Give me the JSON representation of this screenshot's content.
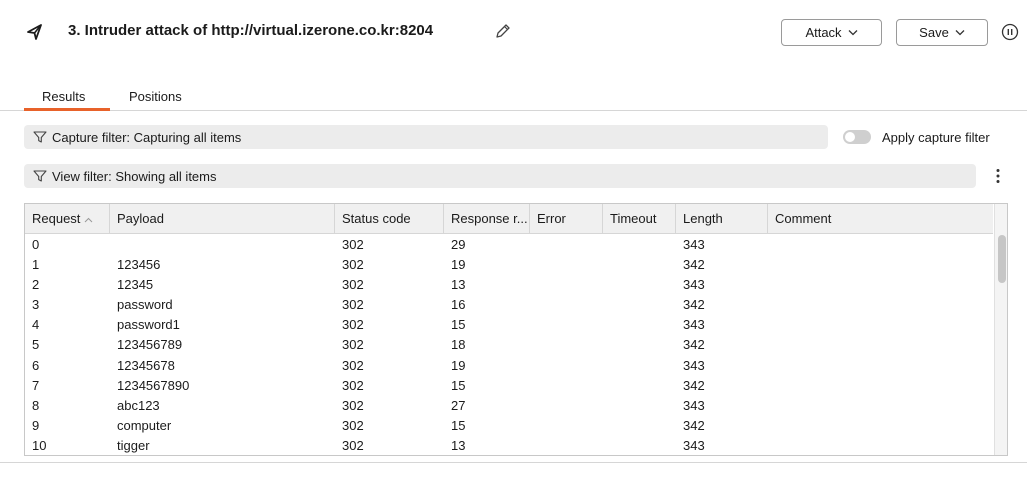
{
  "header": {
    "title": "3. Intruder attack of http://virtual.izerone.co.kr:8204",
    "attack_label": "Attack",
    "save_label": "Save"
  },
  "tabs": [
    {
      "label": "Results",
      "active": true
    },
    {
      "label": "Positions",
      "active": false
    }
  ],
  "filters": {
    "capture": "Capture filter: Capturing all items",
    "view": "View filter: Showing all items",
    "apply_capture_label": "Apply capture filter",
    "apply_capture_enabled": false
  },
  "accent_color": "#e8622a",
  "table": {
    "columns": [
      "Request",
      "Payload",
      "Status code",
      "Response r...",
      "Error",
      "Timeout",
      "Length",
      "Comment"
    ],
    "sorted_column": "Request",
    "rows": [
      [
        "0",
        "",
        "302",
        "29",
        "",
        "",
        "343",
        ""
      ],
      [
        "1",
        "123456",
        "302",
        "19",
        "",
        "",
        "342",
        ""
      ],
      [
        "2",
        "12345",
        "302",
        "13",
        "",
        "",
        "343",
        ""
      ],
      [
        "3",
        "password",
        "302",
        "16",
        "",
        "",
        "342",
        ""
      ],
      [
        "4",
        "password1",
        "302",
        "15",
        "",
        "",
        "343",
        ""
      ],
      [
        "5",
        "123456789",
        "302",
        "18",
        "",
        "",
        "342",
        ""
      ],
      [
        "6",
        "12345678",
        "302",
        "19",
        "",
        "",
        "343",
        ""
      ],
      [
        "7",
        "1234567890",
        "302",
        "15",
        "",
        "",
        "342",
        ""
      ],
      [
        "8",
        "abc123",
        "302",
        "27",
        "",
        "",
        "343",
        ""
      ],
      [
        "9",
        "computer",
        "302",
        "15",
        "",
        "",
        "342",
        ""
      ],
      [
        "10",
        "tigger",
        "302",
        "13",
        "",
        "",
        "343",
        ""
      ]
    ]
  }
}
